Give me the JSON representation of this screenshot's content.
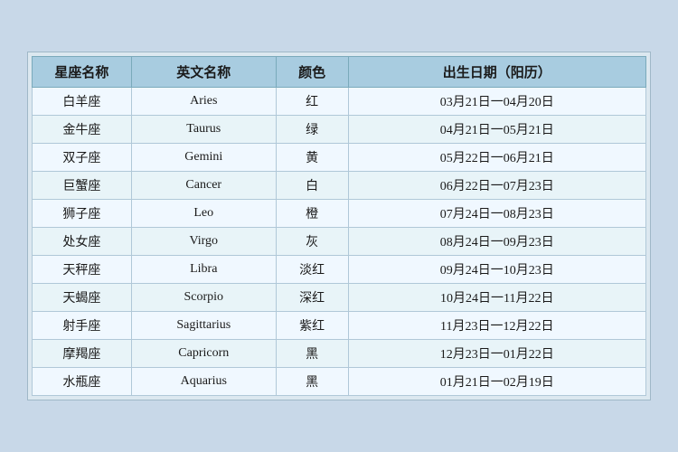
{
  "table": {
    "headers": [
      "星座名称",
      "英文名称",
      "颜色",
      "出生日期（阳历）"
    ],
    "rows": [
      {
        "chinese": "白羊座",
        "english": "Aries",
        "color": "红",
        "dates": "03月21日一04月20日"
      },
      {
        "chinese": "金牛座",
        "english": "Taurus",
        "color": "绿",
        "dates": "04月21日一05月21日"
      },
      {
        "chinese": "双子座",
        "english": "Gemini",
        "color": "黄",
        "dates": "05月22日一06月21日"
      },
      {
        "chinese": "巨蟹座",
        "english": "Cancer",
        "color": "白",
        "dates": "06月22日一07月23日"
      },
      {
        "chinese": "狮子座",
        "english": "Leo",
        "color": "橙",
        "dates": "07月24日一08月23日"
      },
      {
        "chinese": "处女座",
        "english": "Virgo",
        "color": "灰",
        "dates": "08月24日一09月23日"
      },
      {
        "chinese": "天秤座",
        "english": "Libra",
        "color": "淡红",
        "dates": "09月24日一10月23日"
      },
      {
        "chinese": "天蝎座",
        "english": "Scorpio",
        "color": "深红",
        "dates": "10月24日一11月22日"
      },
      {
        "chinese": "射手座",
        "english": "Sagittarius",
        "color": "紫红",
        "dates": "11月23日一12月22日"
      },
      {
        "chinese": "摩羯座",
        "english": "Capricorn",
        "color": "黑",
        "dates": "12月23日一01月22日"
      },
      {
        "chinese": "水瓶座",
        "english": "Aquarius",
        "color": "黑",
        "dates": "01月21日一02月19日"
      }
    ]
  }
}
